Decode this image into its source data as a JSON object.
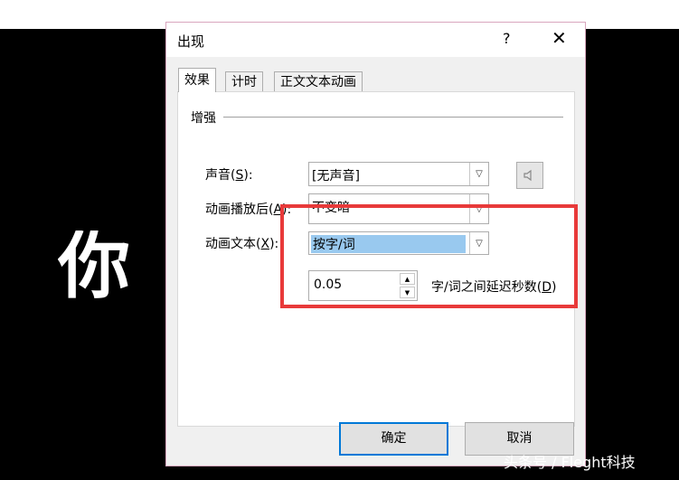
{
  "slide": {
    "text": "你"
  },
  "dialog": {
    "title": "出现",
    "help": "?",
    "close": "✕",
    "tabs": [
      {
        "label": "效果",
        "active": true
      },
      {
        "label": "计时",
        "active": false
      },
      {
        "label": "正文文本动画",
        "active": false
      }
    ],
    "group_label": "增强",
    "sound": {
      "label": "声音(",
      "key": "S",
      "suffix": "):",
      "value": "[无声音]"
    },
    "after_animation": {
      "label": "动画播放后(",
      "key": "A",
      "suffix": "):",
      "value": "不变暗"
    },
    "animate_text": {
      "label": "动画文本(",
      "key": "X",
      "suffix": "):",
      "value": "按字/词"
    },
    "delay": {
      "value": "0.05",
      "label": "字/词之间延迟秒数(",
      "key": "D",
      "suffix": ")"
    },
    "ok_label": "确定",
    "cancel_label": "取消"
  },
  "watermark": "头条号 / Fleght科技",
  "colors": {
    "highlight": "#99c9ef",
    "annotation_box": "#e83a3a",
    "default_button_border": "#0078d7"
  }
}
